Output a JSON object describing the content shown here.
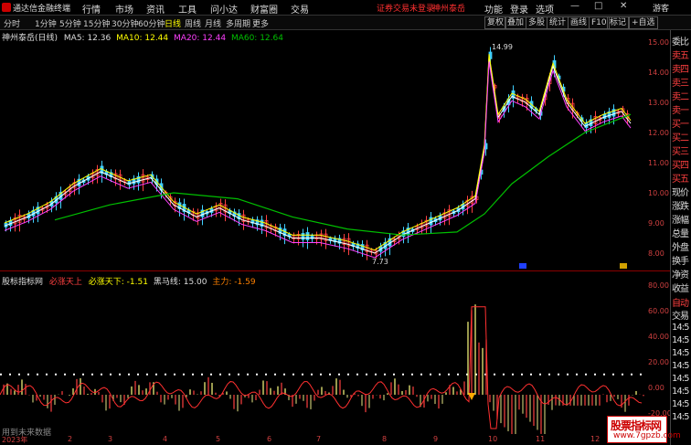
{
  "menubar": {
    "app_title": "通达信金融终端",
    "menus": [
      "行情",
      "市场",
      "资讯",
      "工具",
      "问小达",
      "财富圈",
      "交易"
    ],
    "login_status": "证券交易未登录",
    "broker": "神州泰岳",
    "right_menus": [
      "功能",
      "登录",
      "选项"
    ],
    "user": "游客",
    "window_buttons": [
      "—",
      "□",
      "✕"
    ]
  },
  "toolbar": {
    "timeframes": [
      "分时",
      "1分钟",
      "5分钟",
      "15分钟",
      "30分钟",
      "60分钟",
      "日线",
      "周线",
      "月线",
      "多周期",
      "更多"
    ],
    "active_timeframe": "日线",
    "buttons": [
      "叠加",
      "多股",
      "统计",
      "画线",
      "F10",
      "标记",
      "+自选"
    ],
    "first_button": "复权"
  },
  "chart_header": {
    "stock": "神州泰岳(日线)",
    "ma5": "MA5: 12.36",
    "ma10": "MA10: 12.44",
    "ma20": "MA20: 12.44",
    "ma60": "MA60: 12.64"
  },
  "price_axis": [
    "15.00",
    "14.00",
    "13.00",
    "12.00",
    "11.00",
    "10.00",
    "9.00",
    "8.00"
  ],
  "annotations": {
    "high": "14.99",
    "low": "7.73"
  },
  "indicator_header": {
    "name": "股标指标网",
    "l1": "必涨天上",
    "l2": "必涨天下: -1.51",
    "l3": "黑马线: 15.00",
    "l4": "主力: -1.59"
  },
  "indicator_axis": [
    "80.00",
    "60.00",
    "40.00",
    "20.00",
    "0.00",
    "-20.00"
  ],
  "future_note": "用到未来数据",
  "x_labels": [
    "2023年",
    "2",
    "3",
    "4",
    "5",
    "6",
    "7",
    "8",
    "9",
    "10",
    "11",
    "12"
  ],
  "right_panel": [
    "委比",
    "卖五",
    "卖四",
    "卖三",
    "卖二",
    "卖一",
    "买一",
    "买二",
    "买三",
    "买四",
    "买五",
    "现价",
    "涨跌",
    "涨幅",
    "总量",
    "外盘",
    "换手",
    "净资",
    "收益"
  ],
  "right_panel_lower": [
    "自动",
    "交易",
    "14:5",
    "14:5",
    "14:5",
    "14:5",
    "14:5",
    "14:5",
    "14:5",
    "14:5",
    "14:5",
    "14:5",
    "14:5"
  ],
  "watermark": {
    "line1": "股票指标网",
    "line2": "www.7gpzb.com"
  },
  "colors": {
    "ma5": "#ffffff",
    "ma10": "#ffff00",
    "ma20": "#ff40ff",
    "ma60": "#00c000",
    "up": "#ff4040",
    "down": "#40d0ff"
  }
}
